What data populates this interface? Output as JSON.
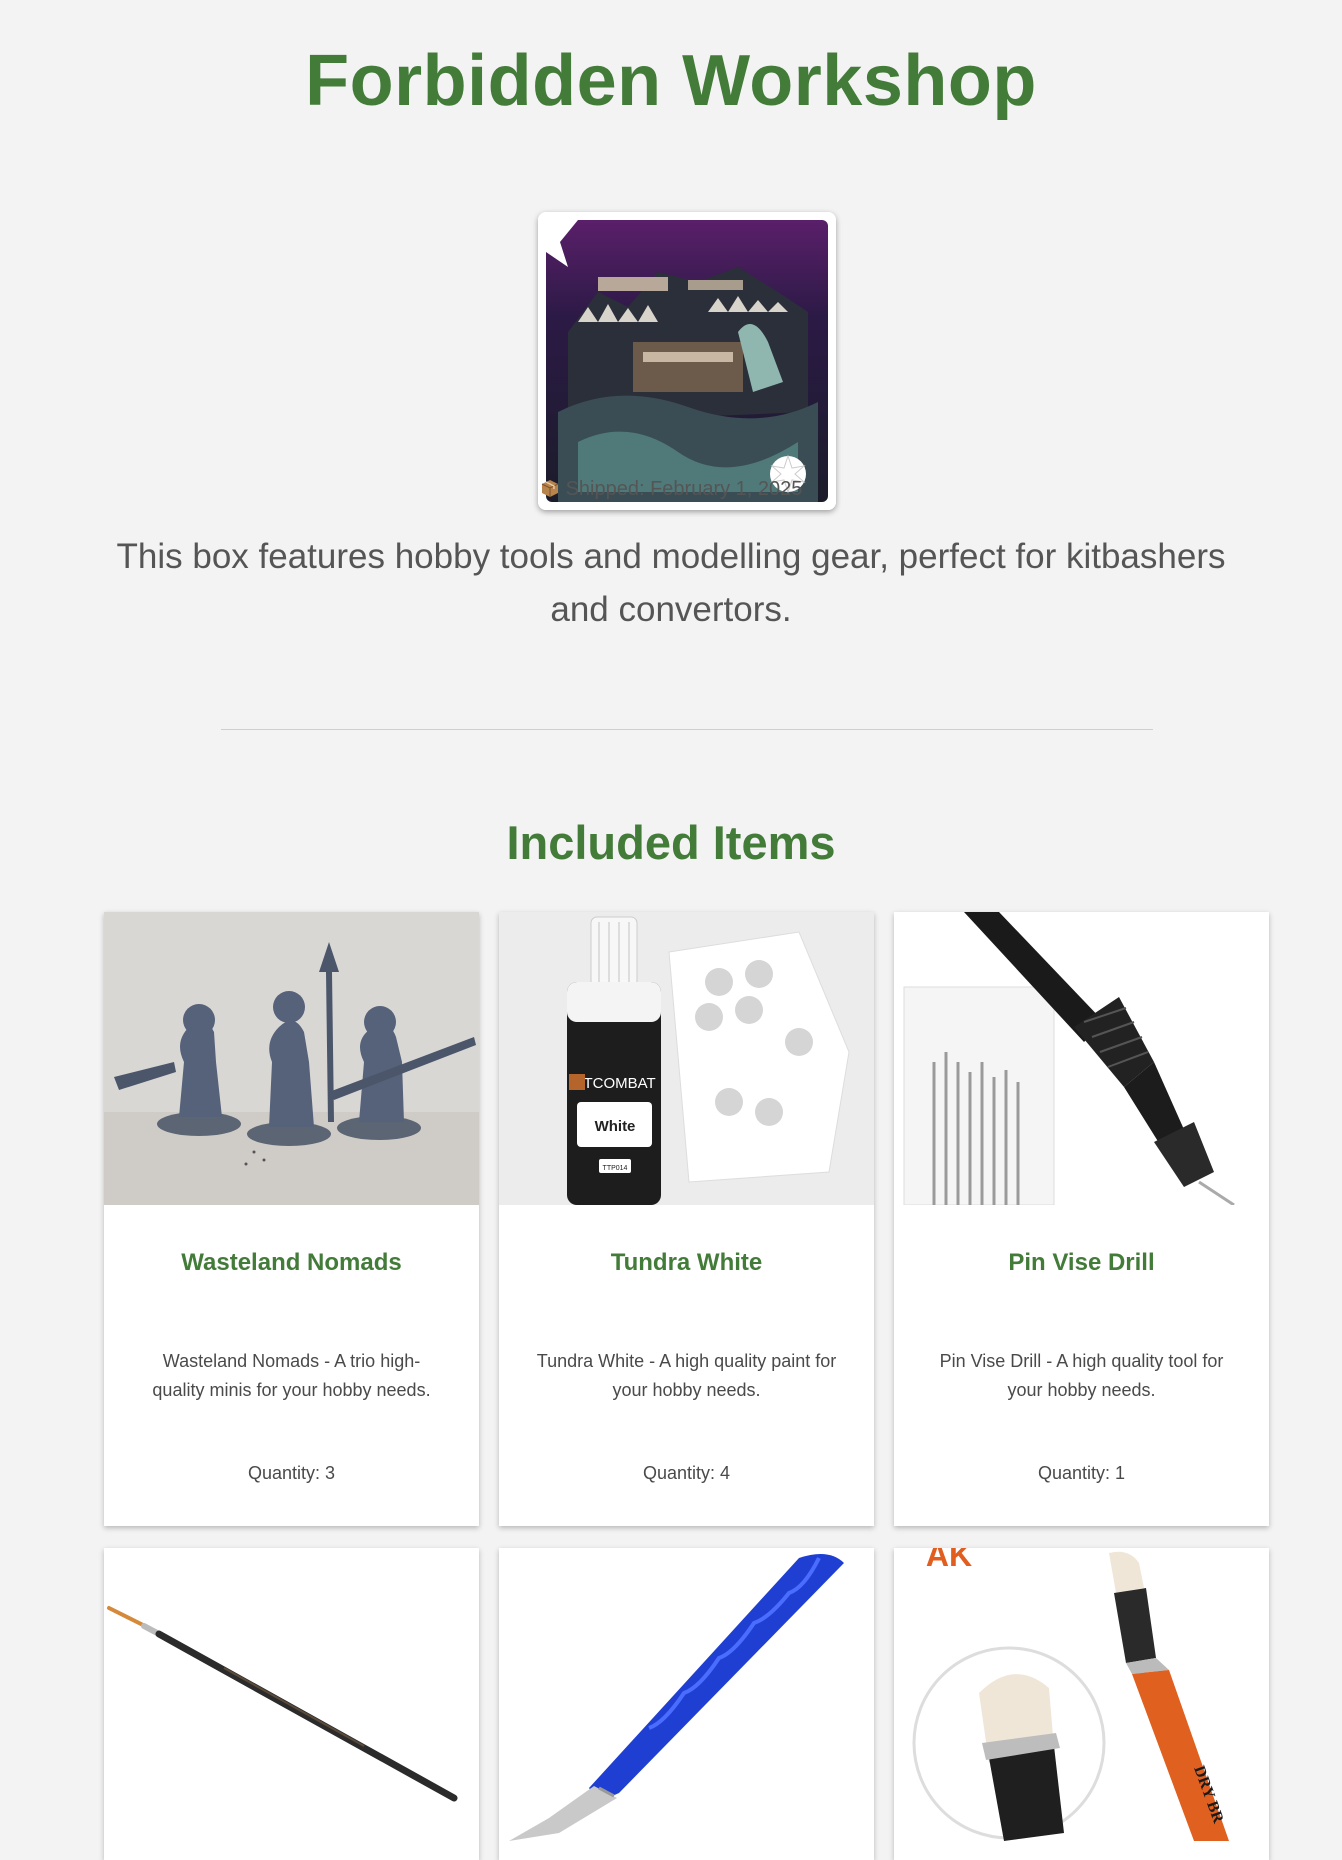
{
  "page": {
    "title": "Forbidden Workshop",
    "shipped_icon": "package-icon",
    "shipped_text": "Shipped: February 1, 2025",
    "description": "This box features hobby tools and modelling gear, perfect for kitbashers and convertors.",
    "section_title": "Included Items"
  },
  "colors": {
    "accent_green": "#437b39",
    "background": "#f3f3f3",
    "card_bg": "#ffffff"
  },
  "items": [
    {
      "name": "Wasteland Nomads",
      "description": "Wasteland Nomads - A trio high-quality minis for your hobby needs.",
      "quantity": "Quantity: 3",
      "image_icon": "miniatures-image"
    },
    {
      "name": "Tundra White",
      "description": "Tundra White - A high quality paint for your hobby needs.",
      "quantity": "Quantity: 4",
      "image_icon": "paint-bottle-image",
      "image_label_brand": "TTCOMBAT",
      "image_label_color": "White",
      "image_label_code": "TTP014"
    },
    {
      "name": "Pin Vise Drill",
      "description": "Pin Vise Drill - A high quality tool for your hobby needs.",
      "quantity": "Quantity: 1",
      "image_icon": "pin-vise-image"
    },
    {
      "image_icon": "paint-brush-image"
    },
    {
      "image_icon": "hobby-knife-image"
    },
    {
      "image_icon": "dry-brush-image",
      "image_label_brand": "AK",
      "image_label_text": "DRY BR"
    }
  ]
}
